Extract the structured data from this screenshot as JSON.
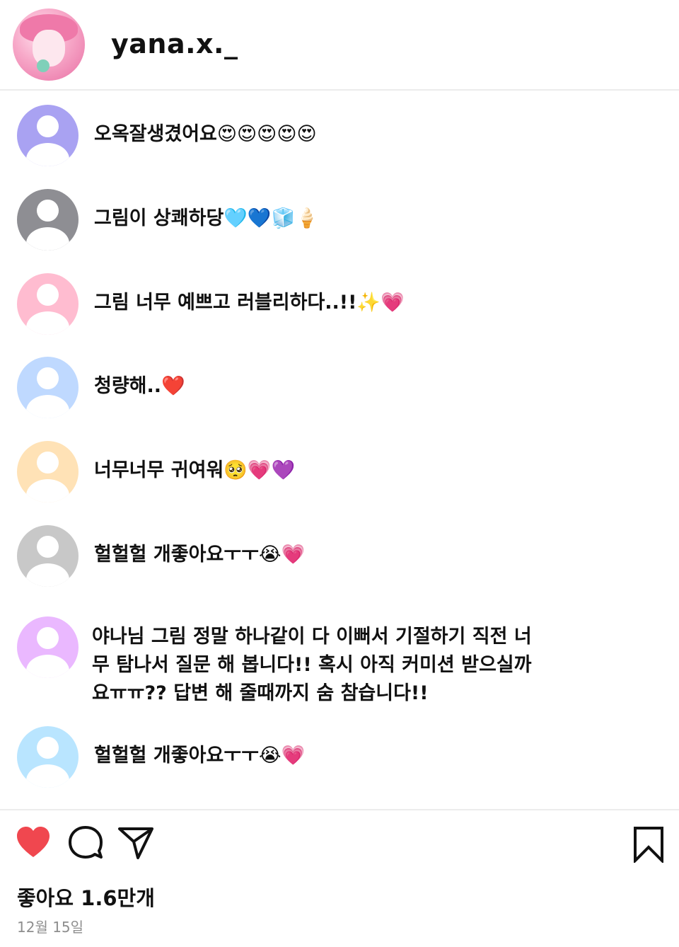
{
  "header": {
    "username": "yana.x._"
  },
  "comments": [
    {
      "text": "오옥잘생겼어요😍😍😍😍😍",
      "avatar_color": "#a9a2f2"
    },
    {
      "text": "그림이 상쾌하당🩵💙🧊🍦",
      "avatar_color": "#8e8e93"
    },
    {
      "text": "그림 너무 예쁘고 러블리하다..!!✨💗",
      "avatar_color": "#ffbcd0"
    },
    {
      "text": "청량해..❤️",
      "avatar_color": "#bfd9ff"
    },
    {
      "text": "너무너무 귀여워🥺💗💜",
      "avatar_color": "#ffe2b6"
    },
    {
      "text": "헐헐헐 개좋아요ㅜㅜ😭💗",
      "avatar_color": "#c8c8c8"
    },
    {
      "text": "야나님 그림 정말 하나같이 다 이뻐서 기절하기 직전 너무 탐나서 질문 해 봅니다!! 혹시 아직 커미션 받으실까요ㅠㅠ?? 답변 해 줄때까지 숨 참습니다!!",
      "avatar_color": "#eab8ff"
    },
    {
      "text": "헐헐헐 개좋아요ㅜㅜ😭💗",
      "avatar_color": "#b9e5ff"
    }
  ],
  "footer": {
    "likes": "좋아요 1.6만개",
    "date": "12월 15일",
    "heart_color": "#f0474f",
    "icons": [
      "heart-icon",
      "comment-icon",
      "share-icon",
      "bookmark-icon"
    ]
  }
}
